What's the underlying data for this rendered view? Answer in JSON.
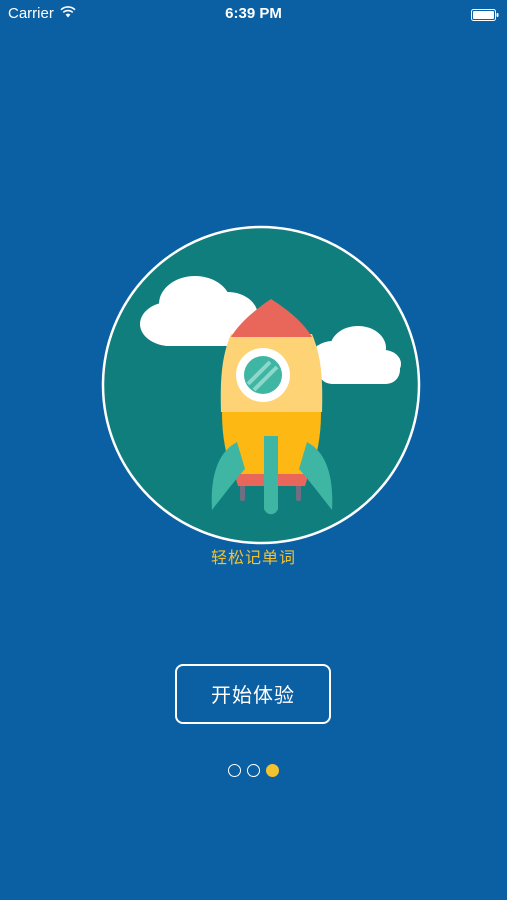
{
  "status_bar": {
    "carrier": "Carrier",
    "time": "6:39 PM"
  },
  "illustration": {
    "icon": "rocket-icon",
    "circle_color": "#117E7E",
    "cloud_color": "#FFFFFF"
  },
  "slogan": "轻松记单词",
  "start_button": {
    "label": "开始体验"
  },
  "pager": {
    "page_count": 3,
    "current_page": 3,
    "active_color": "#F2C230"
  },
  "colors": {
    "background": "#0B5FA3",
    "accent": "#F2C230"
  }
}
